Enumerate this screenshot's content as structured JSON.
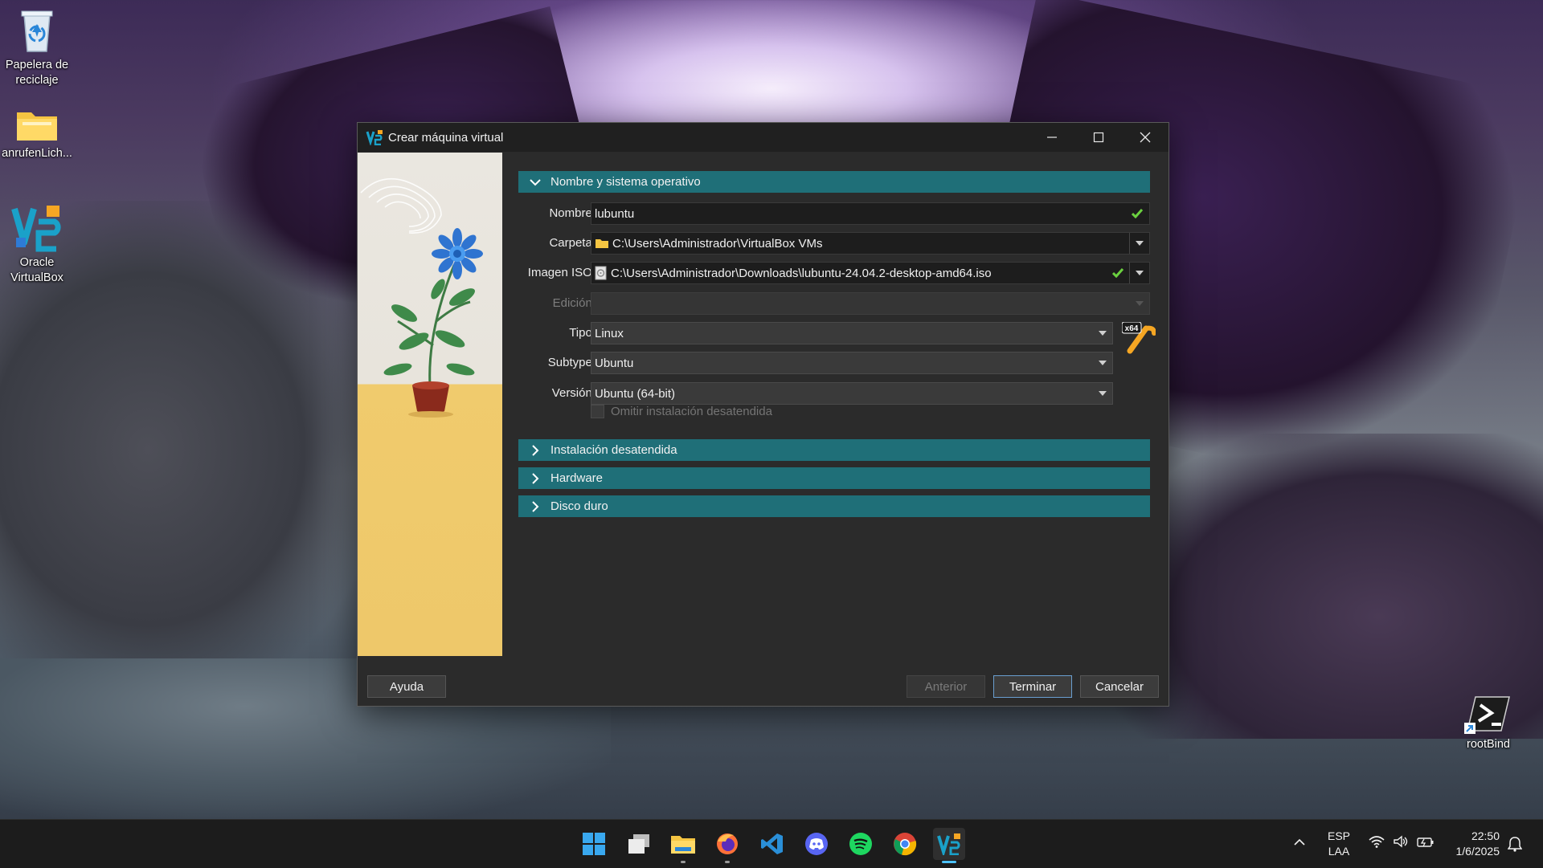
{
  "desktop": {
    "icons": [
      {
        "label": "Papelera de reciclaje",
        "icon": "recycle-bin-icon"
      },
      {
        "label": "anrufenLich...",
        "icon": "folder-icon"
      },
      {
        "label": "Oracle VirtualBox",
        "icon": "virtualbox-icon"
      },
      {
        "label": "rootBind",
        "icon": "terminal-shortcut-icon"
      }
    ]
  },
  "window": {
    "title": "Crear máquina virtual",
    "sections": {
      "name_os": {
        "label": "Nombre y sistema operativo",
        "expanded": true
      },
      "unattended": {
        "label": "Instalación desatendida",
        "expanded": false
      },
      "hardware": {
        "label": "Hardware",
        "expanded": false
      },
      "disk": {
        "label": "Disco duro",
        "expanded": false
      }
    },
    "fields": {
      "nombre": {
        "label": "Nombre:",
        "value": "lubuntu"
      },
      "carpeta": {
        "label": "Carpeta:",
        "value": "C:\\Users\\Administrador\\VirtualBox VMs"
      },
      "iso": {
        "label": "Imagen ISO:",
        "value": "C:\\Users\\Administrador\\Downloads\\lubuntu-24.04.2-desktop-amd64.iso"
      },
      "edicion": {
        "label": "Edición:",
        "value": ""
      },
      "tipo": {
        "label": "Tipo:",
        "value": "Linux"
      },
      "subtype": {
        "label": "Subtype:",
        "value": "Ubuntu"
      },
      "version": {
        "label": "Versión:",
        "value": "Ubuntu (64-bit)"
      },
      "os_badge": "x64"
    },
    "omit_unattended": {
      "label": "Omitir instalación desatendida",
      "checked": false
    },
    "buttons": {
      "help": "Ayuda",
      "back": "Anterior",
      "finish": "Terminar",
      "cancel": "Cancelar"
    }
  },
  "taskbar": {
    "apps": [
      "windows-start-icon",
      "task-view-icon",
      "file-explorer-icon",
      "firefox-icon",
      "vscode-icon",
      "discord-icon",
      "spotify-icon",
      "chrome-icon",
      "virtualbox-icon"
    ],
    "tray": {
      "lang_top": "ESP",
      "lang_bottom": "LAA",
      "time": "22:50",
      "date": "1/6/2025"
    }
  },
  "colors": {
    "section_header": "#1f6f78",
    "check_green": "#6bd13f",
    "accent_blue": "#4cc2ff"
  }
}
